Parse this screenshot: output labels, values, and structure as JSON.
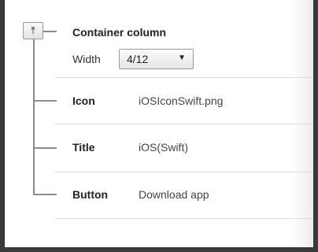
{
  "container": {
    "title": "Container column",
    "collapse_glyph": "⤒",
    "width_label": "Width",
    "width_value": "4/12",
    "caret": "▼"
  },
  "rows": [
    {
      "label": "Icon",
      "value": "iOSIconSwift.png"
    },
    {
      "label": "Title",
      "value": "iOS(Swift)"
    },
    {
      "label": "Button",
      "value": "Download app"
    }
  ]
}
